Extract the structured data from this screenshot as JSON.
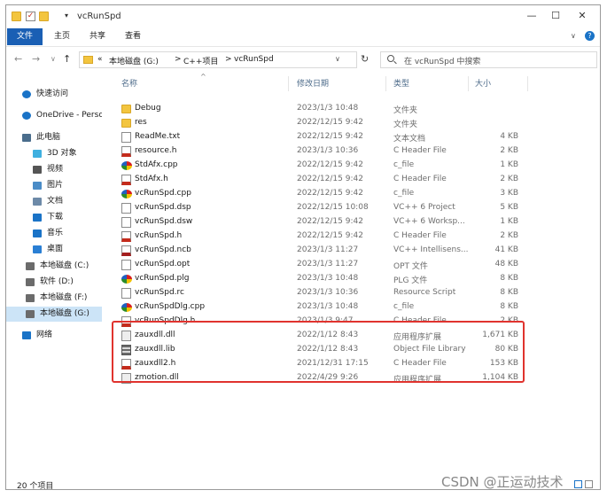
{
  "window": {
    "title": "vcRunSpd"
  },
  "ribbon": {
    "tabs": [
      "文件",
      "主页",
      "共享",
      "查看"
    ]
  },
  "address": {
    "back": "←",
    "forward": "→",
    "dropdown": "∨",
    "up": "↑",
    "crumbs": [
      "«",
      "本地磁盘 (G:)",
      ">",
      "C++项目",
      ">",
      "vcRunSpd"
    ],
    "search_placeholder": "在 vcRunSpd 中搜索"
  },
  "sidebar": {
    "items": [
      {
        "label": "快速访问",
        "icon": "star-icon"
      },
      {
        "label": "OneDrive - Perso",
        "icon": "cloud-icon"
      },
      {
        "label": "此电脑",
        "icon": "computer-icon"
      },
      {
        "label": "3D 对象",
        "icon": "cube-icon"
      },
      {
        "label": "视频",
        "icon": "video-icon"
      },
      {
        "label": "图片",
        "icon": "picture-icon"
      },
      {
        "label": "文档",
        "icon": "document-icon"
      },
      {
        "label": "下载",
        "icon": "download-icon"
      },
      {
        "label": "音乐",
        "icon": "music-icon"
      },
      {
        "label": "桌面",
        "icon": "desktop-icon"
      },
      {
        "label": "本地磁盘 (C:)",
        "icon": "drive-icon"
      },
      {
        "label": "软件 (D:)",
        "icon": "drive-icon"
      },
      {
        "label": "本地磁盘 (F:)",
        "icon": "drive-icon"
      },
      {
        "label": "本地磁盘 (G:)",
        "icon": "drive-icon",
        "selected": true
      },
      {
        "label": "网络",
        "icon": "network-icon"
      }
    ]
  },
  "columns": {
    "name": "名称",
    "date": "修改日期",
    "type": "类型",
    "size": "大小"
  },
  "files": [
    {
      "name": "Debug",
      "date": "2023/1/3 10:48",
      "type": "文件夹",
      "size": "",
      "icon": "folder"
    },
    {
      "name": "res",
      "date": "2022/12/15 9:42",
      "type": "文件夹",
      "size": "",
      "icon": "folder"
    },
    {
      "name": "ReadMe.txt",
      "date": "2022/12/15 9:42",
      "type": "文本文档",
      "size": "4 KB",
      "icon": "txt"
    },
    {
      "name": "resource.h",
      "date": "2023/1/3 10:36",
      "type": "C Header File",
      "size": "2 KB",
      "icon": "h"
    },
    {
      "name": "StdAfx.cpp",
      "date": "2022/12/15 9:42",
      "type": "c_file",
      "size": "1 KB",
      "icon": "cpp"
    },
    {
      "name": "StdAfx.h",
      "date": "2022/12/15 9:42",
      "type": "C Header File",
      "size": "2 KB",
      "icon": "h"
    },
    {
      "name": "vcRunSpd.cpp",
      "date": "2022/12/15 9:42",
      "type": "c_file",
      "size": "3 KB",
      "icon": "cpp"
    },
    {
      "name": "vcRunSpd.dsp",
      "date": "2022/12/15 10:08",
      "type": "VC++ 6 Project",
      "size": "5 KB",
      "icon": "txt"
    },
    {
      "name": "vcRunSpd.dsw",
      "date": "2022/12/15 9:42",
      "type": "VC++ 6 Worksp...",
      "size": "1 KB",
      "icon": "txt"
    },
    {
      "name": "vcRunSpd.h",
      "date": "2022/12/15 9:42",
      "type": "C Header File",
      "size": "2 KB",
      "icon": "h"
    },
    {
      "name": "vcRunSpd.ncb",
      "date": "2023/1/3 11:27",
      "type": "VC++ Intellisens...",
      "size": "41 KB",
      "icon": "ncb"
    },
    {
      "name": "vcRunSpd.opt",
      "date": "2023/1/3 11:27",
      "type": "OPT 文件",
      "size": "48 KB",
      "icon": "txt"
    },
    {
      "name": "vcRunSpd.plg",
      "date": "2023/1/3 10:48",
      "type": "PLG 文件",
      "size": "8 KB",
      "icon": "cpp"
    },
    {
      "name": "vcRunSpd.rc",
      "date": "2023/1/3 10:36",
      "type": "Resource Script",
      "size": "8 KB",
      "icon": "txt"
    },
    {
      "name": "vcRunSpdDlg.cpp",
      "date": "2023/1/3 10:48",
      "type": "c_file",
      "size": "8 KB",
      "icon": "cpp"
    },
    {
      "name": "vcRunSpdDlg.h",
      "date": "2023/1/3 9:47",
      "type": "C Header File",
      "size": "2 KB",
      "icon": "h"
    },
    {
      "name": "zauxdll.dll",
      "date": "2022/1/12 8:43",
      "type": "应用程序扩展",
      "size": "1,671 KB",
      "icon": "dll"
    },
    {
      "name": "zauxdll.lib",
      "date": "2022/1/12 8:43",
      "type": "Object File Library",
      "size": "80 KB",
      "icon": "lib"
    },
    {
      "name": "zauxdll2.h",
      "date": "2021/12/31 17:15",
      "type": "C Header File",
      "size": "153 KB",
      "icon": "h"
    },
    {
      "name": "zmotion.dll",
      "date": "2022/4/29 9:26",
      "type": "应用程序扩展",
      "size": "1,104 KB",
      "icon": "dll"
    }
  ],
  "status": {
    "count": "20 个项目"
  },
  "watermark": "CSDN @正运动技术"
}
